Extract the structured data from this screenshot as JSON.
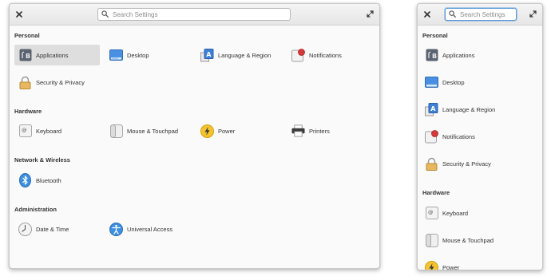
{
  "wide_window": {
    "search": {
      "placeholder": "Search Settings"
    },
    "sections": [
      {
        "title": "Personal",
        "items": [
          {
            "label": "Applications",
            "icon": "applications-icon",
            "selected": true
          },
          {
            "label": "Desktop",
            "icon": "desktop-icon"
          },
          {
            "label": "Language & Region",
            "icon": "language-icon"
          },
          {
            "label": "Notifications",
            "icon": "notifications-icon"
          },
          {
            "label": "Security & Privacy",
            "icon": "lock-icon"
          }
        ]
      },
      {
        "title": "Hardware",
        "items": [
          {
            "label": "Keyboard",
            "icon": "keyboard-icon"
          },
          {
            "label": "Mouse & Touchpad",
            "icon": "mouse-icon"
          },
          {
            "label": "Power",
            "icon": "power-icon"
          },
          {
            "label": "Printers",
            "icon": "printer-icon"
          }
        ]
      },
      {
        "title": "Network & Wireless",
        "items": [
          {
            "label": "Bluetooth",
            "icon": "bluetooth-icon"
          }
        ]
      },
      {
        "title": "Administration",
        "items": [
          {
            "label": "Date & Time",
            "icon": "clock-icon"
          },
          {
            "label": "Universal Access",
            "icon": "accessibility-icon"
          }
        ]
      }
    ]
  },
  "narrow_window": {
    "search": {
      "placeholder": "Search Settings"
    },
    "sections": [
      {
        "title": "Personal",
        "items": [
          {
            "label": "Applications",
            "icon": "applications-icon"
          },
          {
            "label": "Desktop",
            "icon": "desktop-icon"
          },
          {
            "label": "Language & Region",
            "icon": "language-icon"
          },
          {
            "label": "Notifications",
            "icon": "notifications-icon"
          },
          {
            "label": "Security & Privacy",
            "icon": "lock-icon"
          }
        ]
      },
      {
        "title": "Hardware",
        "items": [
          {
            "label": "Keyboard",
            "icon": "keyboard-icon"
          },
          {
            "label": "Mouse & Touchpad",
            "icon": "mouse-icon"
          },
          {
            "label": "Power",
            "icon": "power-icon"
          }
        ]
      }
    ]
  },
  "colors": {
    "accent_focus": "#5d9ad6",
    "selected_bg": "#dedede",
    "notification_dot": "#d43a3a",
    "power_yellow": "#f4c430",
    "bluetooth_blue": "#3d8fe0"
  }
}
